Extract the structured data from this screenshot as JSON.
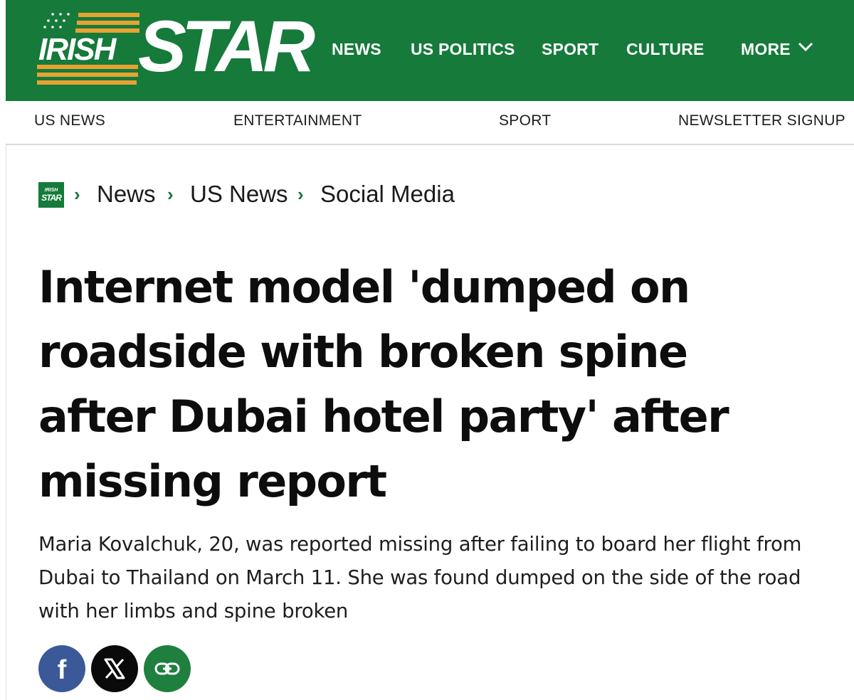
{
  "brand": {
    "logo_word_small": "IRISH",
    "logo_word_large": "STAR",
    "primary_color": "#157a3a",
    "accent_color": "#e8a232"
  },
  "main_nav": {
    "items": [
      "NEWS",
      "US POLITICS",
      "SPORT",
      "CULTURE",
      "MORE"
    ],
    "more_icon": "chevron-down-icon"
  },
  "sub_nav": {
    "items": [
      "US NEWS",
      "ENTERTAINMENT",
      "SPORT",
      "NEWSLETTER SIGNUP"
    ]
  },
  "breadcrumb": {
    "home_icon": "irish-star-mini-logo",
    "home_logo_text": [
      "IRISH",
      "STAR"
    ],
    "separator_icon": "chevron-right-icon",
    "items": [
      "News",
      "US News",
      "Social Media"
    ]
  },
  "article": {
    "headline": "Internet model 'dumped on roadside with broken spine after Dubai hotel party' after missing report",
    "standfirst": "Maria Kovalchuk, 20, was reported missing after failing to board her flight from Dubai to Thailand on March 11. She was found dumped on the side of the road with her limbs and spine broken"
  },
  "share": {
    "buttons": [
      {
        "icon": "facebook-icon",
        "color": "#3b5998"
      },
      {
        "icon": "x-icon",
        "color": "#0a0a0a"
      },
      {
        "icon": "link-icon",
        "color": "#1f7f3f"
      }
    ]
  }
}
